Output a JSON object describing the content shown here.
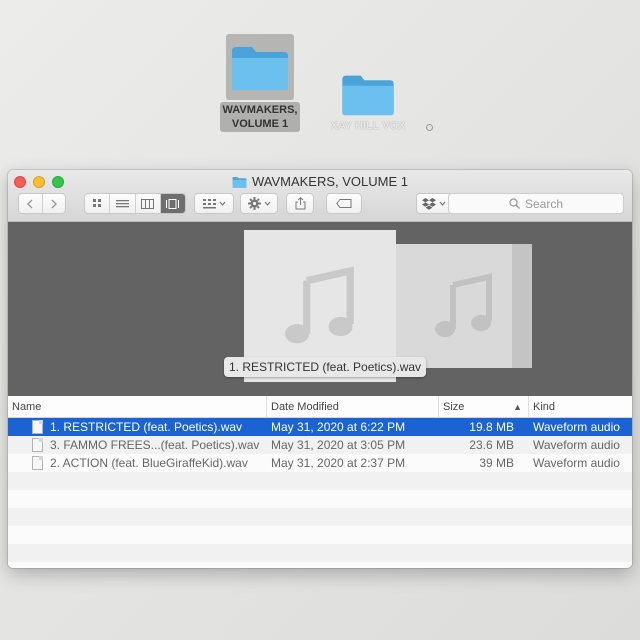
{
  "desktop": {
    "icons": [
      {
        "label_line1": "WAVMAKERS,",
        "label_line2": "VOLUME 1",
        "selected": true
      },
      {
        "label_line1": "XAY HILL VOX",
        "label_line2": "",
        "selected": false
      }
    ]
  },
  "colors": {
    "folder": "#5ab4e6",
    "selection": "#1b63d3",
    "coverflow_bg": "#636363"
  },
  "window": {
    "title": "WAVMAKERS, VOLUME 1",
    "title_icon": "folder-icon",
    "toolbar": {
      "back_icon": "chevron-left-icon",
      "forward_icon": "chevron-right-icon",
      "view_modes": [
        "icon-view",
        "list-view",
        "column-view",
        "cover-flow-view"
      ],
      "active_view": "cover-flow-view",
      "arrange_icon": "arrange-grid-icon",
      "action_icon": "gear-icon",
      "share_icon": "share-icon",
      "tag_icon": "tag-icon",
      "dropbox_icon": "dropbox-icon",
      "search_placeholder": "Search"
    },
    "coverflow": {
      "current_label": "1. RESTRICTED (feat. Poetics).wav",
      "artwork_icon": "music-note-icon"
    },
    "columns": {
      "name": "Name",
      "date": "Date Modified",
      "size": "Size",
      "kind": "Kind",
      "sorted_by": "Size",
      "sort_direction": "ascending"
    },
    "files": [
      {
        "name": "1. RESTRICTED (feat. Poetics).wav",
        "date": "May 31, 2020 at 6:22 PM",
        "size": "19.8 MB",
        "kind": "Waveform audio",
        "selected": true
      },
      {
        "name": "3. FAMMO FREES...(feat. Poetics).wav",
        "date": "May 31, 2020 at 3:05 PM",
        "size": "23.6 MB",
        "kind": "Waveform audio",
        "selected": false
      },
      {
        "name": "2. ACTION (feat. BlueGiraffeKid).wav",
        "date": "May 31, 2020 at 2:37 PM",
        "size": "39 MB",
        "kind": "Waveform audio",
        "selected": false
      }
    ]
  }
}
